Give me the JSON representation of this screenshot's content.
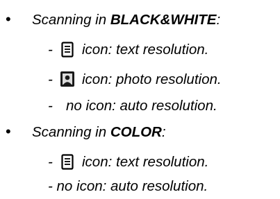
{
  "bw": {
    "prefix": "Scanning in ",
    "mode": "BLACK&WHITE",
    "suffix": ":",
    "items": [
      {
        "dash": "-",
        "icon": "text-document-icon",
        "text": "icon: text resolution."
      },
      {
        "dash": "-",
        "icon": "photo-portrait-icon",
        "text": "icon: photo resolution."
      },
      {
        "dash": "-",
        "icon": "",
        "text": "no icon: auto resolution."
      }
    ]
  },
  "color": {
    "prefix": "Scanning in ",
    "mode": "COLOR",
    "suffix": ":",
    "items": [
      {
        "dash": "-",
        "icon": "text-document-icon",
        "text": "icon: text resolution."
      },
      {
        "dash": "-",
        "icon": "",
        "text": "- no icon: auto resolution."
      }
    ]
  },
  "bullet_char": "•"
}
